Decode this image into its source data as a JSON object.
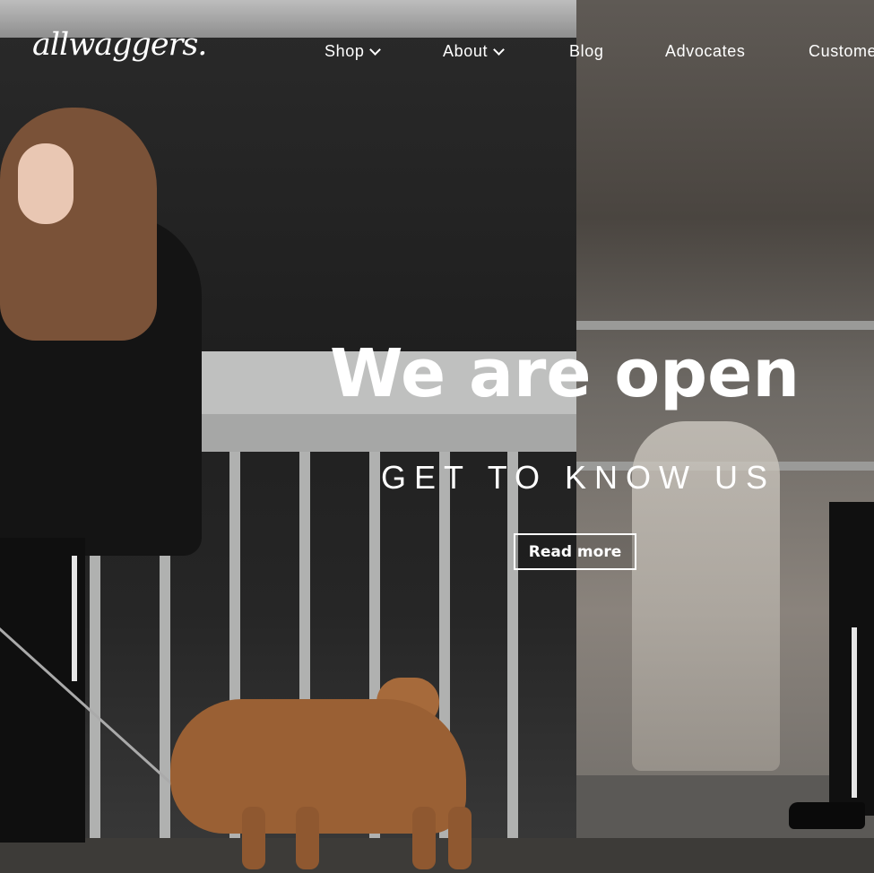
{
  "brand": {
    "logo_text": "allwaggers."
  },
  "nav": {
    "items": [
      {
        "label": "Shop",
        "has_dropdown": true
      },
      {
        "label": "About",
        "has_dropdown": true
      },
      {
        "label": "Blog",
        "has_dropdown": false
      },
      {
        "label": "Advocates",
        "has_dropdown": false
      },
      {
        "label": "Customer",
        "has_dropdown": false
      }
    ]
  },
  "hero": {
    "headline": "We are open",
    "subheadline": "GET TO KNOW US",
    "cta_label": "Read more",
    "text_color": "#ffffff"
  }
}
